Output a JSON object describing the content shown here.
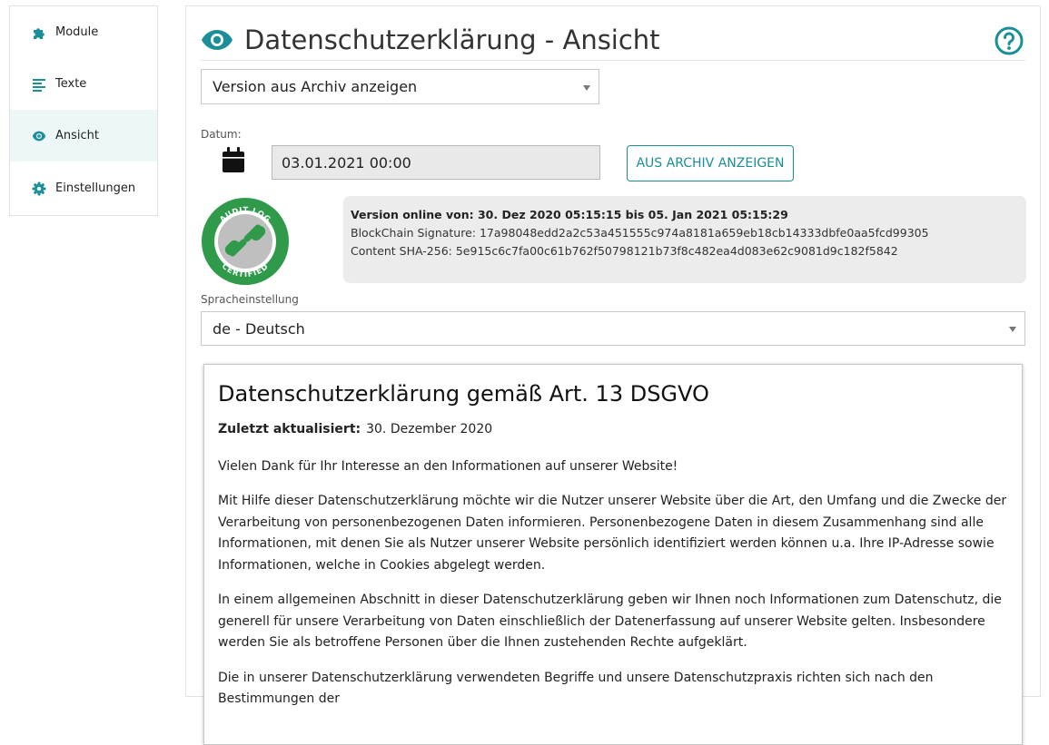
{
  "sidebar": {
    "items": [
      {
        "label": "Module",
        "icon": "puzzle-icon"
      },
      {
        "label": "Texte",
        "icon": "align-left-icon"
      },
      {
        "label": "Ansicht",
        "icon": "eye-icon",
        "active": true
      },
      {
        "label": "Einstellungen",
        "icon": "gear-icon"
      }
    ]
  },
  "header": {
    "title": "Datenschutzerklärung - Ansicht"
  },
  "archive_select": {
    "value": "Version aus Archiv anzeigen"
  },
  "date": {
    "label": "Datum:",
    "value": "03.01.2021 00:00"
  },
  "archive_button": {
    "label": "AUS ARCHIV ANZEIGEN"
  },
  "audit_badge": {
    "top_text": "AUDIT LOG",
    "bottom_text": "CERTIFIED"
  },
  "info": {
    "line1": "Version online von: 30. Dez 2020 05:15:15 bis 05. Jan 2021 05:15:29",
    "line2": "BlockChain Signature: 17a98048edd2a2c53a451555c974a8181a659eb18cb14333dbfe0aa5fcd99305",
    "line3": "Content SHA-256: 5e915c6c7fa00c61b762f50798121b73f8c482ea4d083e62c9081d9c182f5842"
  },
  "language": {
    "label": "Spracheinstellung",
    "value": "de - Deutsch"
  },
  "document": {
    "heading": "Datenschutzerklärung gemäß Art. 13 DSGVO",
    "updated_label": "Zuletzt aktualisiert:",
    "updated_value": "30. Dezember 2020",
    "paragraphs": [
      "Vielen Dank für Ihr Interesse an den Informationen auf unserer Website!",
      "Mit Hilfe dieser Datenschutzerklärung möchte wir die Nutzer unserer Website über die Art,  den Umfang und die Zwecke der Verarbeitung von personenbezogenen Daten informieren. Personenbezogene Daten in diesem Zusammenhang sind alle Informationen, mit denen Sie als Nutzer unserer Website persönlich identifiziert werden können u.a. Ihre IP-Adresse sowie Informationen, welche in Cookies abgelegt werden.",
      "In einem allgemeinen Abschnitt in dieser Datenschutzerklärung geben wir Ihnen noch Informationen zum Datenschutz, die generell für unsere Verarbeitung von Daten einschließlich der Datenerfassung auf unserer Website gelten. Insbesondere werden Sie als betroffene Personen über die Ihnen zustehenden Rechte aufgeklärt.",
      "Die in unserer Datenschutzerklärung verwendeten Begriffe und unsere Datenschutzpraxis richten sich nach den Bestimmungen der"
    ]
  },
  "colors": {
    "accent": "#1a8f98",
    "badge_green": "#2e9a4a",
    "active_bg": "#eef7f8",
    "info_bg": "#ececec"
  }
}
